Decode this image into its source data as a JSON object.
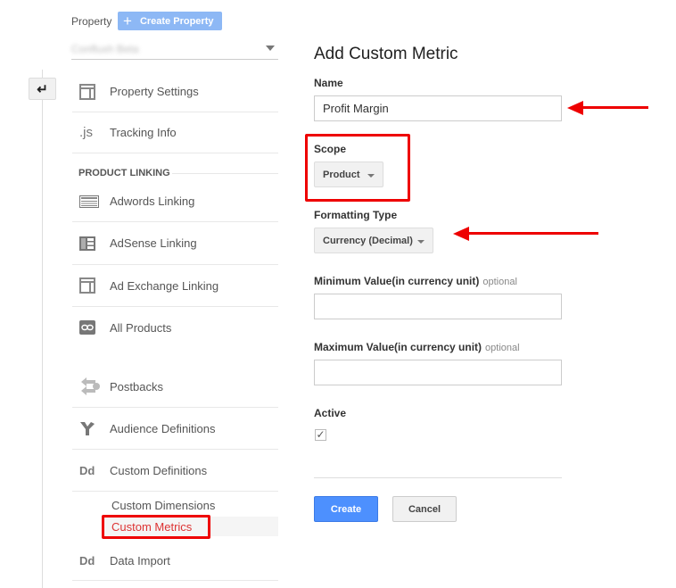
{
  "header": {
    "property_label": "Property",
    "create_property_label": "Create Property",
    "property_name_blurred": "Confluxh Beta"
  },
  "sidebar": {
    "back_icon": "back-arrow-icon",
    "items": [
      {
        "icon": "property-settings-icon",
        "glyph": "",
        "label": "Property Settings"
      },
      {
        "icon": "js-icon",
        "glyph": ".js",
        "label": "Tracking Info"
      },
      {
        "icon": "adwords-icon",
        "glyph": "",
        "label": "Adwords Linking"
      },
      {
        "icon": "adsense-icon",
        "glyph": "",
        "label": "AdSense Linking"
      },
      {
        "icon": "ad-exchange-icon",
        "glyph": "",
        "label": "Ad Exchange Linking"
      },
      {
        "icon": "link-icon",
        "glyph": "",
        "label": "All Products"
      },
      {
        "icon": "postbacks-icon",
        "glyph": "",
        "label": "Postbacks"
      },
      {
        "icon": "audience-icon",
        "glyph": "",
        "label": "Audience Definitions"
      },
      {
        "icon": "dd-icon",
        "glyph": "Dd",
        "label": "Custom Definitions"
      },
      {
        "icon": "dd-icon",
        "glyph": "Dd",
        "label": "Data Import"
      }
    ],
    "section_header": "PRODUCT LINKING",
    "sub_items": [
      {
        "label": "Custom Dimensions",
        "active": false
      },
      {
        "label": "Custom Metrics",
        "active": true
      }
    ]
  },
  "form": {
    "title": "Add Custom Metric",
    "name_label": "Name",
    "name_value": "Profit Margin",
    "scope_label": "Scope",
    "scope_value": "Product",
    "formatting_label": "Formatting Type",
    "formatting_value": "Currency (Decimal)",
    "min_label": "Minimum Value(in currency unit)",
    "min_optional": "optional",
    "min_value": "",
    "max_label": "Maximum Value(in currency unit)",
    "max_optional": "optional",
    "max_value": "",
    "active_label": "Active",
    "active_checked": "✓",
    "create_label": "Create",
    "cancel_label": "Cancel"
  },
  "annotations": {
    "color": "#ee0000"
  }
}
